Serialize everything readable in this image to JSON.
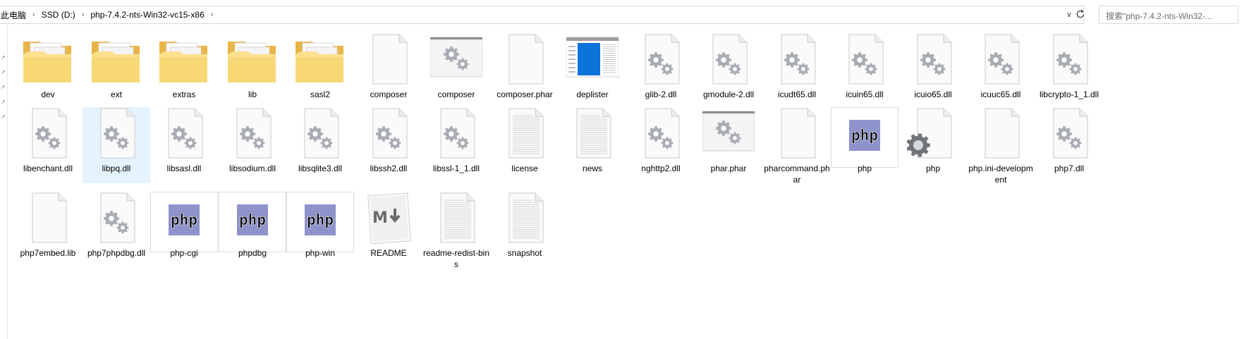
{
  "breadcrumb": [
    "此电脑",
    "SSD (D:)",
    "php-7.4.2-nts-Win32-vc15-x86"
  ],
  "search": {
    "placeholder": "搜索\"php-7.4.2-nts-Win32-..."
  },
  "files": [
    {
      "name": "dev",
      "icon": "folder-icon"
    },
    {
      "name": "ext",
      "icon": "folder-icon"
    },
    {
      "name": "extras",
      "icon": "folder-icon"
    },
    {
      "name": "lib",
      "icon": "folder-icon"
    },
    {
      "name": "sasl2",
      "icon": "folder-icon"
    },
    {
      "name": "composer",
      "icon": "blank-file-icon"
    },
    {
      "name": "composer",
      "icon": "app-window-icon"
    },
    {
      "name": "composer.phar",
      "icon": "blank-file-icon"
    },
    {
      "name": "deplister",
      "icon": "app-preview-icon"
    },
    {
      "name": "glib-2.dll",
      "icon": "dll-file-icon"
    },
    {
      "name": "gmodule-2.dll",
      "icon": "dll-file-icon"
    },
    {
      "name": "icudt65.dll",
      "icon": "dll-file-icon"
    },
    {
      "name": "icuin65.dll",
      "icon": "dll-file-icon"
    },
    {
      "name": "icuio65.dll",
      "icon": "dll-file-icon"
    },
    {
      "name": "icuuc65.dll",
      "icon": "dll-file-icon"
    },
    {
      "name": "libcrypto-1_1.dll",
      "icon": "dll-file-icon"
    },
    {
      "name": "libenchant.dll",
      "icon": "dll-file-icon"
    },
    {
      "name": "libpq.dll",
      "icon": "dll-file-icon",
      "selected": true
    },
    {
      "name": "libsasl.dll",
      "icon": "dll-file-icon"
    },
    {
      "name": "libsodium.dll",
      "icon": "dll-file-icon"
    },
    {
      "name": "libsqlite3.dll",
      "icon": "dll-file-icon"
    },
    {
      "name": "libssh2.dll",
      "icon": "dll-file-icon"
    },
    {
      "name": "libssl-1_1.dll",
      "icon": "dll-file-icon"
    },
    {
      "name": "license",
      "icon": "text-file-icon"
    },
    {
      "name": "news",
      "icon": "text-file-icon"
    },
    {
      "name": "nghttp2.dll",
      "icon": "dll-file-icon"
    },
    {
      "name": "phar.phar",
      "icon": "app-window-icon"
    },
    {
      "name": "pharcommand.phar",
      "icon": "blank-file-icon"
    },
    {
      "name": "php",
      "icon": "php-logo-icon",
      "framed": true
    },
    {
      "name": "php",
      "icon": "settings-gear-icon"
    },
    {
      "name": "php.ini-development",
      "icon": "blank-file-icon"
    },
    {
      "name": "php7.dll",
      "icon": "dll-file-icon"
    },
    {
      "name": "php7embed.lib",
      "icon": "blank-file-icon"
    },
    {
      "name": "php7phpdbg.dll",
      "icon": "dll-file-icon"
    },
    {
      "name": "php-cgi",
      "icon": "php-logo-icon",
      "framed": true
    },
    {
      "name": "phpdbg",
      "icon": "php-logo-icon",
      "framed": true
    },
    {
      "name": "php-win",
      "icon": "php-logo-icon",
      "framed": true
    },
    {
      "name": "README",
      "icon": "markdown-icon"
    },
    {
      "name": "readme-redist-bins",
      "icon": "text-file-icon"
    },
    {
      "name": "snapshot",
      "icon": "text-file-icon"
    }
  ]
}
